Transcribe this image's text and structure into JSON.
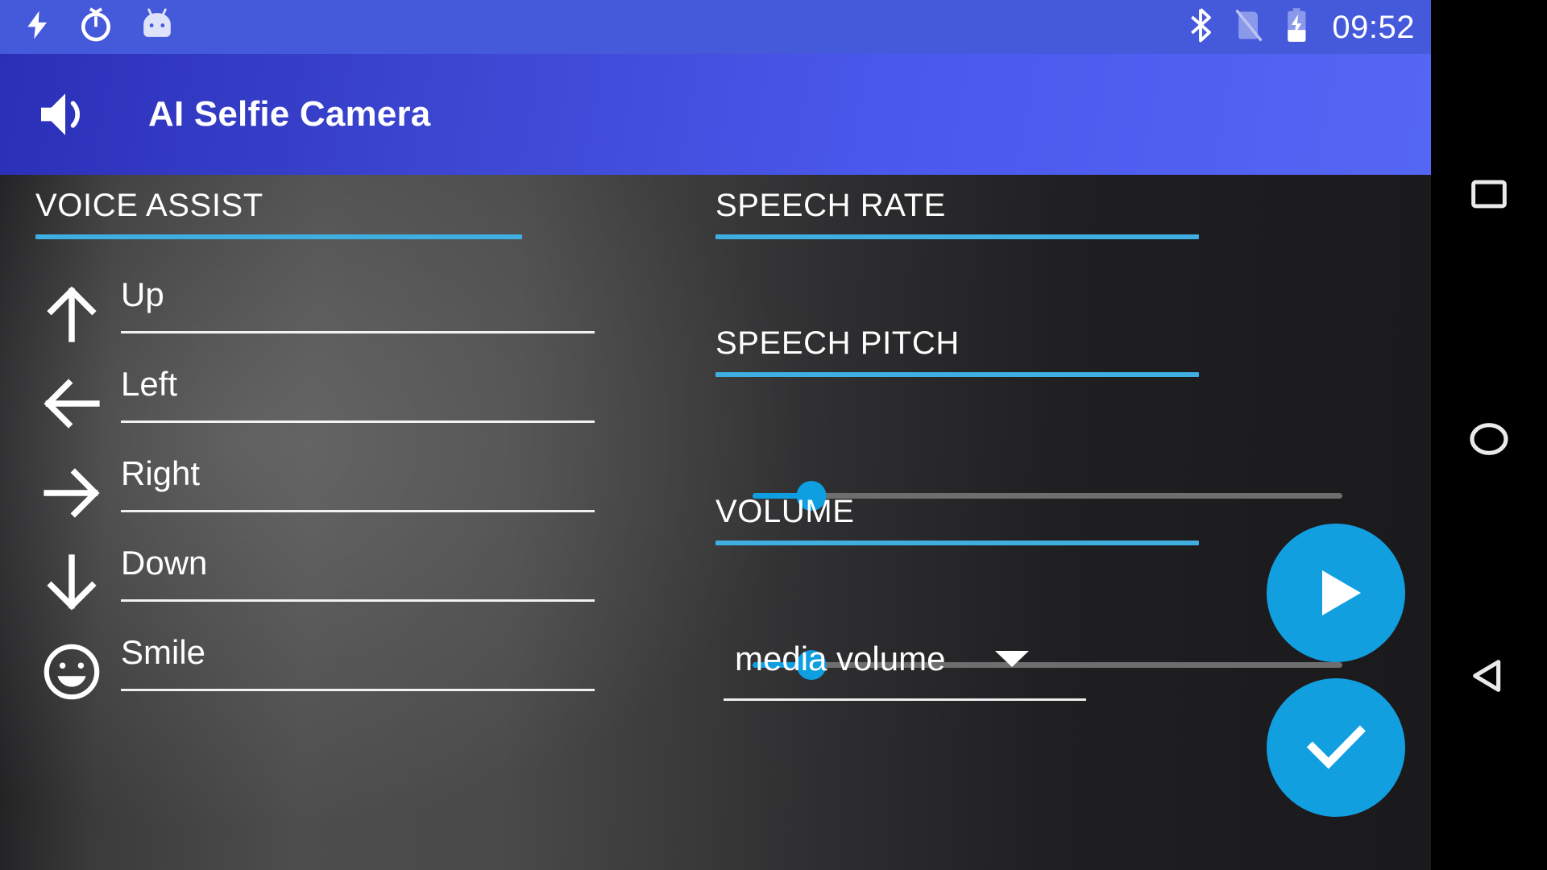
{
  "statusbar": {
    "time": "09:52",
    "left_icons": [
      {
        "name": "flash-icon",
        "label": "flash"
      },
      {
        "name": "alarm-icon",
        "label": "alarm"
      },
      {
        "name": "android-head-icon",
        "label": "android"
      }
    ],
    "right_icons": [
      {
        "name": "bluetooth-icon",
        "label": "bluetooth"
      },
      {
        "name": "signal-off-icon",
        "label": "no signal"
      },
      {
        "name": "battery-charging-icon",
        "label": "battery charging"
      }
    ]
  },
  "appbar": {
    "icon": "volume-speaker-icon",
    "title": "AI Selfie Camera"
  },
  "voice_assist": {
    "header": "VOICE ASSIST",
    "rows": [
      {
        "icon": "arrow-up-icon",
        "value": "Up"
      },
      {
        "icon": "arrow-left-icon",
        "value": "Left"
      },
      {
        "icon": "arrow-right-icon",
        "value": "Right"
      },
      {
        "icon": "arrow-down-icon",
        "value": "Down"
      },
      {
        "icon": "smile-icon",
        "value": "Smile"
      }
    ]
  },
  "speech_rate": {
    "header": "SPEECH RATE",
    "slider": {
      "value_percent": 10,
      "min": 0,
      "max": 100
    }
  },
  "speech_pitch": {
    "header": "SPEECH PITCH",
    "slider": {
      "value_percent": 10,
      "min": 0,
      "max": 100
    }
  },
  "volume": {
    "header": "VOLUME",
    "selected_option": "media volume",
    "caret": "chevron-down-icon"
  },
  "actions": {
    "play": {
      "name": "play-icon",
      "label": "Play"
    },
    "done": {
      "name": "check-icon",
      "label": "Done"
    }
  },
  "navbar": {
    "recents": "square-recents-icon",
    "home": "circle-home-icon",
    "back": "triangle-back-icon"
  },
  "colors": {
    "statusbar_blue": "#4559db",
    "appbar_blue": "#4a58ec",
    "accent_cyan": "#3fafe2",
    "accent_blue": "#0d9fe0",
    "fab_blue": "#129fe0",
    "text_white": "#ffffff"
  }
}
